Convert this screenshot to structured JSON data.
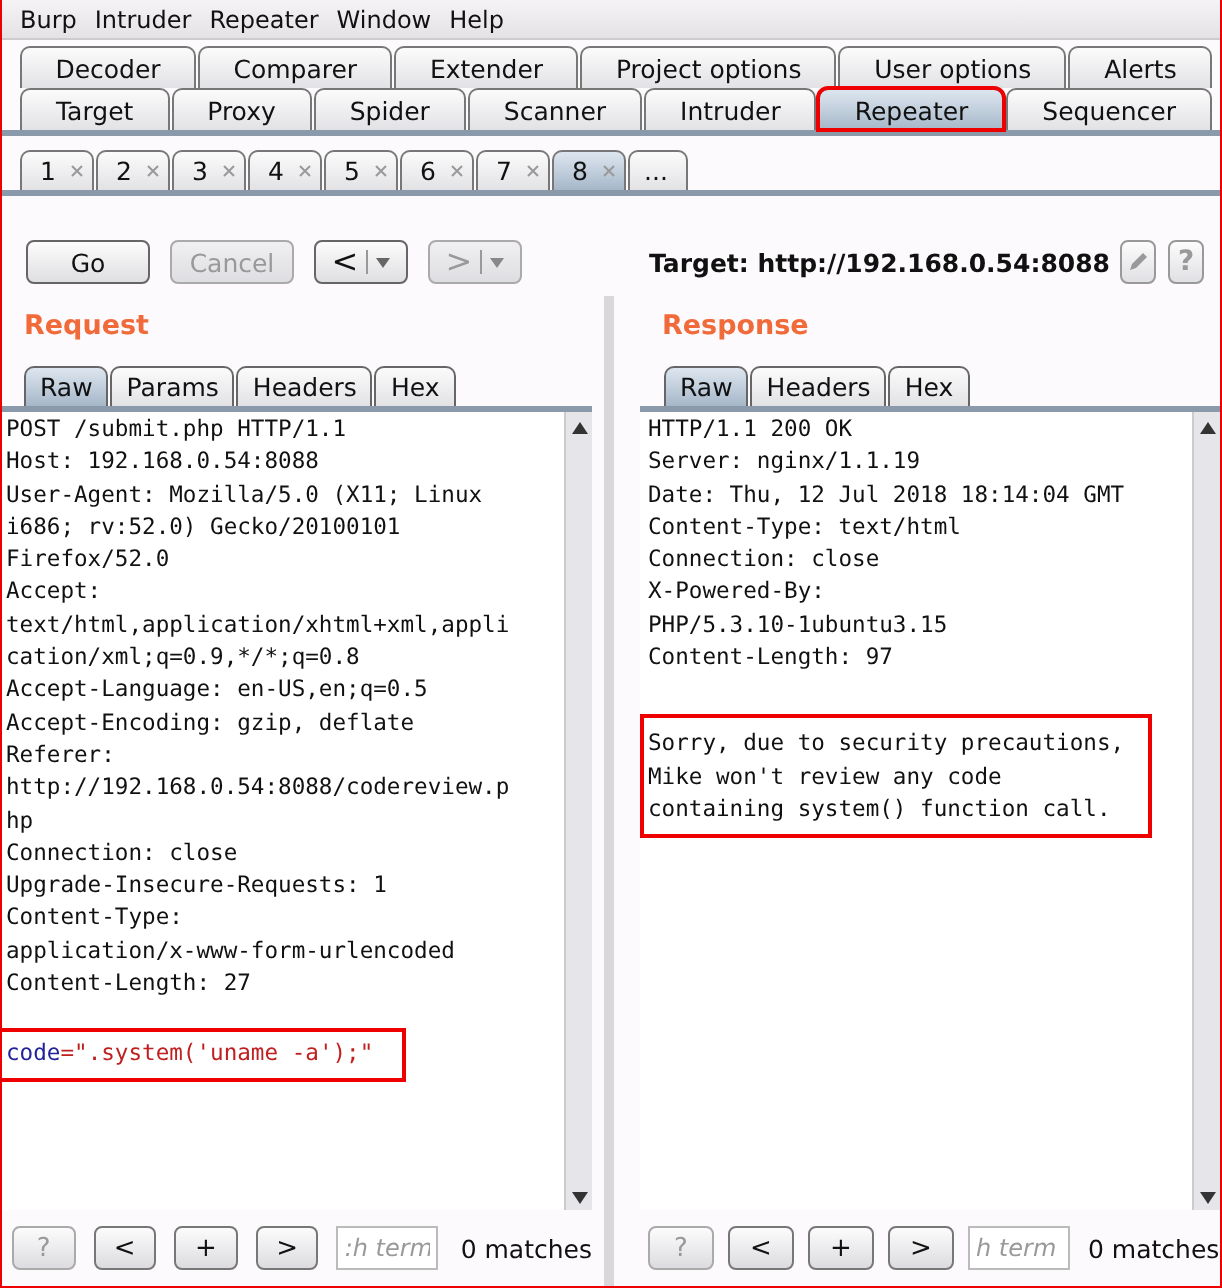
{
  "menu": [
    "Burp",
    "Intruder",
    "Repeater",
    "Window",
    "Help"
  ],
  "tool_tabs_row1": [
    {
      "label": "Decoder",
      "selected": false,
      "highlighted": false
    },
    {
      "label": "Comparer",
      "selected": false,
      "highlighted": false
    },
    {
      "label": "Extender",
      "selected": false,
      "highlighted": false
    },
    {
      "label": "Project options",
      "selected": false,
      "highlighted": false
    },
    {
      "label": "User options",
      "selected": false,
      "highlighted": false
    },
    {
      "label": "Alerts",
      "selected": false,
      "highlighted": false
    }
  ],
  "tool_tabs_row2": [
    {
      "label": "Target",
      "selected": false,
      "highlighted": false
    },
    {
      "label": "Proxy",
      "selected": false,
      "highlighted": false
    },
    {
      "label": "Spider",
      "selected": false,
      "highlighted": false
    },
    {
      "label": "Scanner",
      "selected": false,
      "highlighted": false
    },
    {
      "label": "Intruder",
      "selected": false,
      "highlighted": false
    },
    {
      "label": "Repeater",
      "selected": true,
      "highlighted": true
    },
    {
      "label": "Sequencer",
      "selected": false,
      "highlighted": false
    }
  ],
  "repeater_tabs": [
    {
      "label": "1",
      "selected": false
    },
    {
      "label": "2",
      "selected": false
    },
    {
      "label": "3",
      "selected": false
    },
    {
      "label": "4",
      "selected": false
    },
    {
      "label": "5",
      "selected": false
    },
    {
      "label": "6",
      "selected": false
    },
    {
      "label": "7",
      "selected": false
    },
    {
      "label": "8",
      "selected": true
    }
  ],
  "more_tab": "...",
  "toolbar": {
    "go": "Go",
    "cancel": "Cancel",
    "cancel_disabled": true,
    "back_disabled": false,
    "forward_disabled": true,
    "back": "<",
    "forward": ">",
    "target": "Target: http://192.168.0.54:8088",
    "help": "?"
  },
  "panels": [
    {
      "title": "Request",
      "tabs": [
        {
          "label": "Raw",
          "selected": true
        },
        {
          "label": "Params",
          "selected": false
        },
        {
          "label": "Headers",
          "selected": false
        },
        {
          "label": "Hex",
          "selected": false
        }
      ],
      "lines": [
        "POST /submit.php HTTP/1.1",
        "Host: 192.168.0.54:8088",
        "User-Agent: Mozilla/5.0 (X11; Linux",
        "i686; rv:52.0) Gecko/20100101",
        "Firefox/52.0",
        "Accept:",
        "text/html,application/xhtml+xml,appli",
        "cation/xml;q=0.9,*/*;q=0.8",
        "Accept-Language: en-US,en;q=0.5",
        "Accept-Encoding: gzip, deflate",
        "Referer:",
        "http://192.168.0.54:8088/codereview.p",
        "hp",
        "Connection: close",
        "Upgrade-Insecure-Requests: 1",
        "Content-Type:",
        "application/x-www-form-urlencoded",
        "Content-Length: 27"
      ],
      "body": {
        "kind": "param",
        "param": "code",
        "rest": "=\".system('uname -a');\"",
        "highlighted": true
      },
      "search": {
        "help": "?",
        "prev": "<",
        "add": "+",
        "next": ">",
        "placeholder": ":h term",
        "matches": "0 matches"
      }
    },
    {
      "title": "Response",
      "tabs": [
        {
          "label": "Raw",
          "selected": true
        },
        {
          "label": "Headers",
          "selected": false
        },
        {
          "label": "Hex",
          "selected": false
        }
      ],
      "lines": [
        "HTTP/1.1 200 OK",
        "Server: nginx/1.1.19",
        "Date: Thu, 12 Jul 2018 18:14:04 GMT",
        "Content-Type: text/html",
        "Connection: close",
        "X-Powered-By:",
        "PHP/5.3.10-1ubuntu3.15",
        "Content-Length: 97"
      ],
      "body": {
        "kind": "text",
        "lines": [
          "Sorry, due to security precautions,",
          "Mike won't review any code",
          "containing system() function call."
        ],
        "highlighted": true
      },
      "search": {
        "help": "?",
        "prev": "<",
        "add": "+",
        "next": ">",
        "placeholder": "h term",
        "matches": "0 matches"
      }
    }
  ]
}
